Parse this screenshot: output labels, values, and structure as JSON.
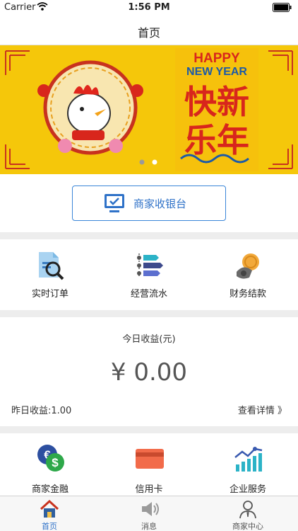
{
  "status_bar": {
    "carrier": "Carrier",
    "time": "1:56 PM"
  },
  "nav": {
    "title": "首页"
  },
  "banner": {
    "headline_en_1": "HAPPY",
    "headline_en_2": "NEW YEAR",
    "headline_cn_1": "快新",
    "headline_cn_2": "乐年",
    "carousel_pages": 2,
    "carousel_active": 2
  },
  "cashier": {
    "label": "商家收银台"
  },
  "quick_menu": [
    {
      "label": "实时订单",
      "icon": "order-search-icon"
    },
    {
      "label": "经营流水",
      "icon": "flow-list-icon"
    },
    {
      "label": "财务结款",
      "icon": "coin-hand-icon"
    }
  ],
  "earnings": {
    "title": "今日收益(元)",
    "amount": "¥ 0.00",
    "yesterday": "昨日收益:1.00",
    "detail_link": "查看详情 》"
  },
  "services": [
    {
      "label": "商家金融",
      "icon": "currency-icon"
    },
    {
      "label": "信用卡",
      "icon": "credit-card-icon"
    },
    {
      "label": "企业服务",
      "icon": "growth-chart-icon"
    }
  ],
  "tabs": [
    {
      "label": "首页",
      "icon": "home-icon",
      "active": true
    },
    {
      "label": "消息",
      "icon": "speaker-icon",
      "active": false
    },
    {
      "label": "商家中心",
      "icon": "merchant-avatar-icon",
      "active": false
    }
  ],
  "colors": {
    "accent": "#2f72c8",
    "banner_bg": "#f5c70a",
    "festive_red": "#d8261c"
  }
}
